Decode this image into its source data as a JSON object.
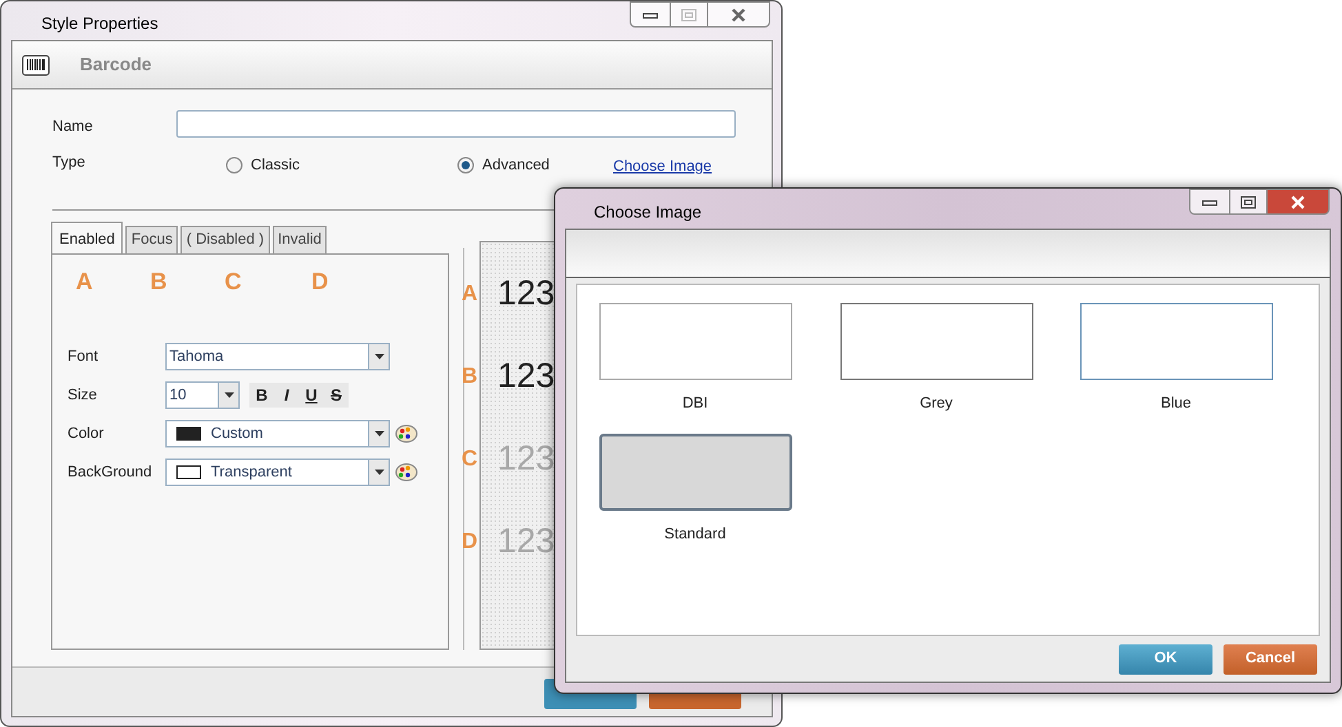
{
  "main_window": {
    "title": "Style Properties",
    "header": "Barcode",
    "name_label": "Name",
    "type": {
      "label": "Type",
      "options": [
        {
          "label": "Classic",
          "selected": false
        },
        {
          "label": "Advanced",
          "selected": true
        }
      ]
    },
    "choose_image_link": "Choose Image",
    "tabs": [
      {
        "label": "Enabled",
        "selected": true
      },
      {
        "label": "Focus",
        "selected": false
      },
      {
        "label": "( Disabled )",
        "selected": false
      },
      {
        "label": "Invalid",
        "selected": false
      }
    ],
    "state_letters": [
      "A",
      "B",
      "C",
      "D"
    ],
    "fields": [
      {
        "kind": "combo",
        "label": "Font",
        "value": "Tahoma"
      },
      {
        "kind": "size",
        "label": "Size",
        "value": "10",
        "format_buttons": [
          "B",
          "I",
          "U",
          "S"
        ]
      },
      {
        "kind": "color",
        "label": "Color",
        "value": "Custom",
        "color": "#222222"
      },
      {
        "kind": "color",
        "label": "BackGround",
        "value": "Transparent",
        "color": "#ffffff"
      }
    ],
    "preview": [
      {
        "letter": "A",
        "sample": "123",
        "color": "#222222"
      },
      {
        "letter": "B",
        "sample": "123",
        "color": "#222222"
      },
      {
        "letter": "C",
        "sample": "123",
        "color": "#a8a8a8"
      },
      {
        "letter": "D",
        "sample": "123",
        "color": "#a8a8a8"
      }
    ],
    "footer_buttons": [
      {
        "kind": "ok"
      },
      {
        "kind": "cancel"
      }
    ]
  },
  "dialog": {
    "title": "Choose Image",
    "styles": [
      {
        "label": "DBI",
        "kind": "plain"
      },
      {
        "label": "Grey",
        "kind": "grey"
      },
      {
        "label": "Blue",
        "kind": "blue"
      },
      {
        "label": "Standard",
        "kind": "standard"
      }
    ],
    "buttons": [
      {
        "label": "OK",
        "kind": "ok"
      },
      {
        "label": "Cancel",
        "kind": "cancel"
      }
    ]
  }
}
